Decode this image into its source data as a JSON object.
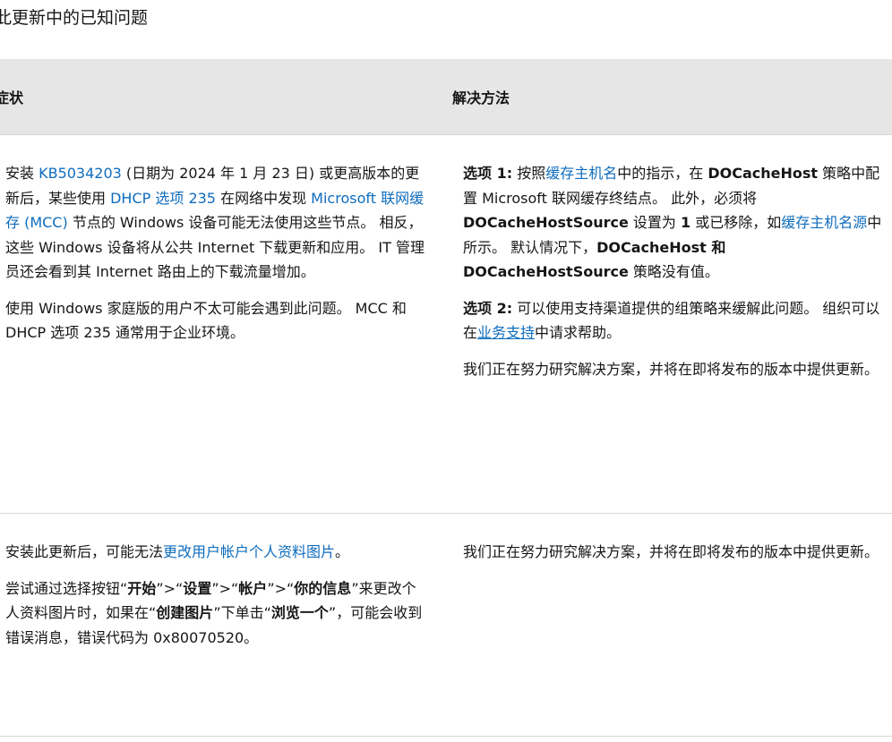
{
  "page": {
    "heading": "此更新中的已知问题"
  },
  "table": {
    "headers": {
      "symptom": "症状",
      "resolution": "解决方法"
    },
    "issue1": {
      "symptom": {
        "p1_t1": "安装 ",
        "p1_link_kb": "KB5034203",
        "p1_t2": " (日期为 2024 年 1 月 23 日) 或更高版本的更新后，某些使用 ",
        "p1_link_dhcp": "DHCP 选项 235",
        "p1_t3": " 在网络中发现 ",
        "p1_link_mcc": "Microsoft 联网缓存 (MCC)",
        "p1_t4": " 节点的 Windows 设备可能无法使用这些节点。 相反，这些 Windows 设备将从公共 Internet 下载更新和应用。 IT 管理员还会看到其 Internet 路由上的下载流量增加。",
        "p2": "使用 Windows 家庭版的用户不太可能会遇到此问题。 MCC 和 DHCP 选项 235 通常用于企业环境。"
      },
      "resolution": {
        "opt1_label": "选项 1:",
        "opt1_t1": " 按照",
        "opt1_link_host": "缓存主机名",
        "opt1_t2": "中的指示，在 ",
        "opt1_policy_host": "DOCacheHost",
        "opt1_t3": " 策略中配置 Microsoft 联网缓存终结点。 此外，必须将 ",
        "opt1_policy_source": "DOCacheHostSource",
        "opt1_t4": " 设置为 ",
        "opt1_value": "1",
        "opt1_t5": " 或已移除，如",
        "opt1_link_source": "缓存主机名源",
        "opt1_t6": "中所示。 默认情况下，",
        "opt1_both": "DOCacheHost 和 DOCacheHostSource",
        "opt1_t7": " 策略没有值。",
        "opt2_label": "选项 2:",
        "opt2_t1": " 可以使用支持渠道提供的组策略来缓解此问题。 组织可以在",
        "opt2_link_support": "业务支持",
        "opt2_t2": "中请求帮助。",
        "p3": "我们正在努力研究解决方案，并将在即将发布的版本中提供更新。"
      }
    },
    "issue2": {
      "symptom": {
        "p1_t1": "安装此更新后，可能无法",
        "p1_link_picture": "更改用户帐户个人资料图片",
        "p1_t2": "。",
        "p2_t1": "尝试通过选择按钮“",
        "p2_start": "开始",
        "p2_t2": "”>“",
        "p2_settings": "设置",
        "p2_t3": "”>“",
        "p2_accounts": "帐户",
        "p2_t4": "”>“",
        "p2_yourinfo": "你的信息",
        "p2_t5": "”来更改个人资料图片时，如果在“",
        "p2_create": "创建图片",
        "p2_t6": "”下单击“",
        "p2_browse": "浏览一个",
        "p2_t7": "”，可能会收到错误消息，错误代码为 0x80070520。"
      },
      "resolution": {
        "p1": "我们正在努力研究解决方案，并将在即将发布的版本中提供更新。"
      }
    }
  }
}
